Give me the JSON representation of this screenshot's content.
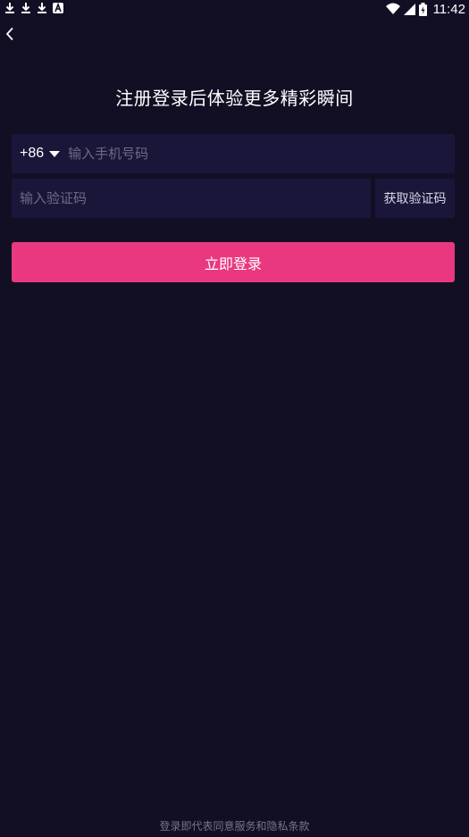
{
  "status_bar": {
    "time": "11:42",
    "left_icons": [
      "download-icon",
      "download-icon",
      "download-icon",
      "a-notification-icon"
    ],
    "right_icons": [
      "wifi-icon",
      "cell-signal-icon",
      "battery-charging-icon"
    ]
  },
  "header": {
    "back_icon": "chevron-left-icon",
    "title": "注册登录后体验更多精彩瞬间"
  },
  "form": {
    "country_code": "+86",
    "phone_placeholder": "输入手机号码",
    "code_placeholder": "输入验证码",
    "get_code_label": "获取验证码",
    "login_label": "立即登录"
  },
  "footer": {
    "terms": "登录即代表同意服务和隐私条款"
  },
  "colors": {
    "background": "#120f24",
    "field_background": "#19163a",
    "accent": "#ea3880"
  }
}
